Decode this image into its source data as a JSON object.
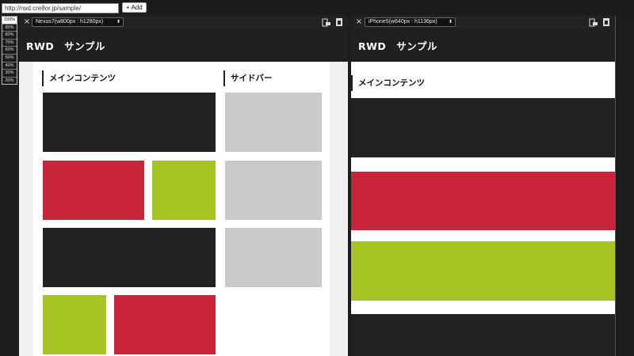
{
  "toolbar": {
    "url_value": "http://rwd.cre8or.jp/sample/",
    "add_label": "+ Add"
  },
  "zoom_levels": [
    "100%",
    "90%",
    "80%",
    "70%",
    "60%",
    "50%",
    "40%",
    "30%",
    "20%"
  ],
  "zoom_selected": "100%",
  "frames": {
    "left": {
      "close_label": "×",
      "device_label": "Nexus7(w800px : h1280px)",
      "site_title": "RWD　サンプル",
      "main_heading": "メインコンテンツ",
      "sidebar_heading": "サイドバー"
    },
    "right": {
      "close_label": "×",
      "device_label": "iPhone5(w640px : h1136px)",
      "site_title": "RWD　サンプル",
      "main_heading": "メインコンテンツ"
    }
  },
  "colors": {
    "dark": "#222222",
    "red": "#c8243b",
    "green": "#a6c523",
    "gray": "#c9c9c9"
  }
}
